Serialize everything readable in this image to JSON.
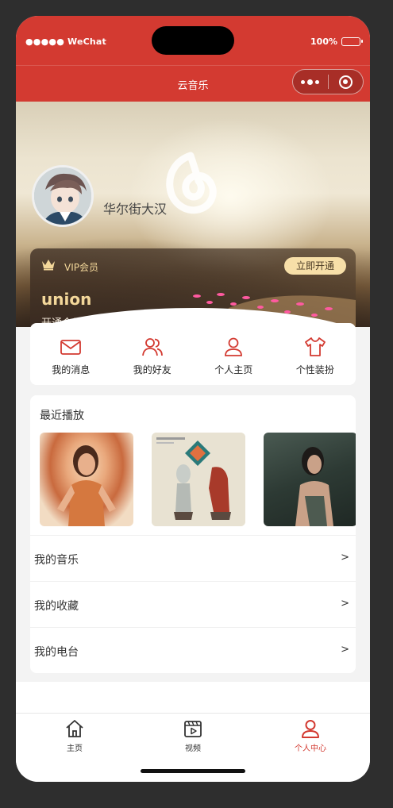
{
  "status_bar": {
    "carrier": "●●●●● WeChat",
    "battery": "100%"
  },
  "nav": {
    "title": "云音乐"
  },
  "profile": {
    "username": "华尔街大汉"
  },
  "vip": {
    "label": "VIP会员",
    "button": "立即开通",
    "title": "union",
    "subtitle": "开通会员听歌"
  },
  "quick_nav": [
    {
      "label": "我的消息",
      "icon": "mail-icon"
    },
    {
      "label": "我的好友",
      "icon": "friends-icon"
    },
    {
      "label": "个人主页",
      "icon": "person-icon"
    },
    {
      "label": "个性装扮",
      "icon": "tshirt-icon"
    }
  ],
  "recent": {
    "title": "最近播放"
  },
  "menu": [
    {
      "label": "我的音乐",
      "arrow": ">"
    },
    {
      "label": "我的收藏",
      "arrow": ">"
    },
    {
      "label": "我的电台",
      "arrow": ">"
    }
  ],
  "tabbar": [
    {
      "label": "主页",
      "icon": "home-icon",
      "active": false
    },
    {
      "label": "视频",
      "icon": "video-icon",
      "active": false
    },
    {
      "label": "个人中心",
      "icon": "person-icon",
      "active": true
    }
  ],
  "colors": {
    "brand": "#d33a31",
    "vip_gold": "#f3d79a",
    "vip_button": "#f7dfa8"
  }
}
